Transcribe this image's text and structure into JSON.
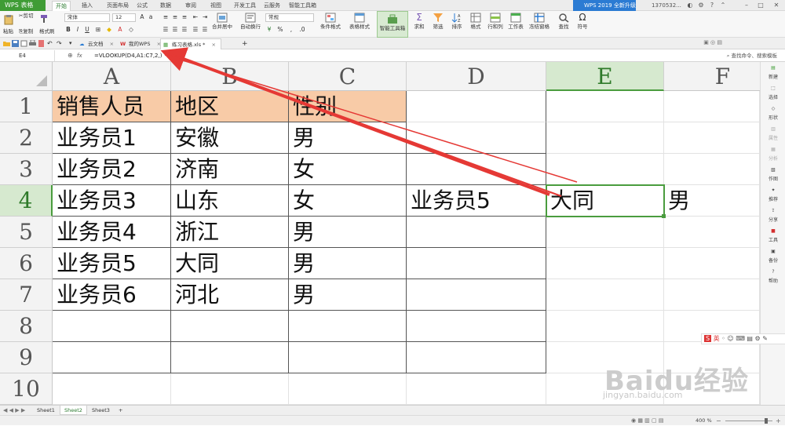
{
  "app": {
    "name": "WPS 表格",
    "upgrade": "WPS 2019 全新升级",
    "account": "1370532..."
  },
  "menu_tabs": [
    "开始",
    "插入",
    "页面布局",
    "公式",
    "数据",
    "审阅",
    "视图",
    "开发工具",
    "云服务",
    "智能工具箱"
  ],
  "ribbon": {
    "cut": "剪切",
    "paste": "粘贴",
    "copy": "复制",
    "format_painter": "格式刷",
    "font": "宋体",
    "size": "12",
    "merge": "合并居中",
    "wrap": "自动换行",
    "numfmt": "常规",
    "cond_format": "条件格式",
    "table_style": "表格样式",
    "smart_toolbox": "智能工具箱",
    "sum": "求和",
    "filter": "筛选",
    "sort": "排序",
    "format": "格式",
    "rowcol": "行和列",
    "worksheet": "工作表",
    "freeze": "冻结窗格",
    "find": "查找",
    "symbol": "符号"
  },
  "doc_tabs": [
    {
      "label": "云文档",
      "icon": "cloud-icon"
    },
    {
      "label": "我的WPS",
      "icon": "wps-icon"
    },
    {
      "label": "练习表格.xls *",
      "icon": "sheet-icon"
    }
  ],
  "formula_bar": {
    "cell_ref": "E4",
    "fx": "fx",
    "formula": "=VLOOKUP(D4,A1:C7,2,)",
    "search": "查找命令、搜索模板"
  },
  "columns": [
    "A",
    "B",
    "C",
    "D",
    "E",
    "F"
  ],
  "rows": [
    "1",
    "2",
    "3",
    "4",
    "5",
    "6",
    "7",
    "8",
    "9",
    "10"
  ],
  "cells": {
    "A1": "销售人员",
    "B1": "地区",
    "C1": "性别",
    "A2": "业务员1",
    "B2": "安徽",
    "C2": "男",
    "A3": "业务员2",
    "B3": "济南",
    "C3": "女",
    "A4": "业务员3",
    "B4": "山东",
    "C4": "女",
    "D4": "业务员5",
    "E4": "大同",
    "F4": "男",
    "A5": "业务员4",
    "B5": "浙江",
    "C5": "男",
    "A6": "业务员5",
    "B6": "大同",
    "C6": "男",
    "A7": "业务员6",
    "B7": "河北",
    "C7": "男"
  },
  "right_panel": [
    "新建",
    "选择",
    "形状",
    "属性",
    "分析",
    "作图",
    "推荐",
    "分享",
    "工具",
    "备份",
    "帮助"
  ],
  "sheets": [
    "Sheet1",
    "Sheet2",
    "Sheet3"
  ],
  "zoom": "400 %",
  "ime_label": "英",
  "watermark": {
    "brand": "Baidu经验",
    "url": "jingyan.baidu.com"
  },
  "colors": {
    "header_fill": "#f8cba7",
    "active": "#4a9c3e",
    "app_green": "#3f9c35",
    "arrow_red": "#e53935"
  }
}
